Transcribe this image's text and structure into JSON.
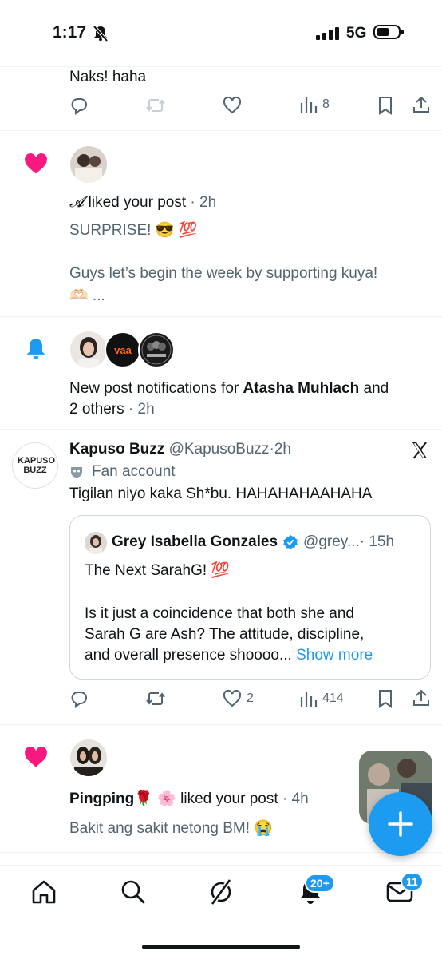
{
  "status_bar": {
    "time": "1:17",
    "network": "5G"
  },
  "post1": {
    "text": "Naks! haha",
    "views": "8"
  },
  "notif_like1": {
    "user": "𝓐",
    "action": " liked your post",
    "time": " · 2h",
    "line1": "SURPRISE! 😎 💯",
    "line2": "Guys let’s begin the week by supporting kuya!",
    "line3": "🫶🏻 ..."
  },
  "notif_post": {
    "prefix": "New post notifications for ",
    "name": "Atasha Muhlach",
    "suffix": " and",
    "line2": "2 others",
    "time": " · 2h",
    "avatar2_text": "vaa"
  },
  "tweet": {
    "avatar_text": "KAPUSO BUZZ",
    "name": "Kapuso Buzz",
    "handle": "@KapusoBuzz",
    "time": "·2h",
    "label": "Fan account",
    "text": "Tigilan niyo kaka Sh*bu. HAHAHAHAAHAHA",
    "quote": {
      "name": "Grey Isabella Gonzales",
      "handle": "@grey...",
      "time": " · 15h",
      "line1": "The Next SarahG! 💯",
      "line2": "Is it just a coincidence that both she and",
      "line3": "Sarah G are Ash? The attitude, discipline,",
      "line4": "and overall presence shoooo...",
      "show_more": " Show more"
    },
    "likes": "2",
    "views": "414"
  },
  "notif_like2": {
    "user": "Pingping",
    "emojis": "🌹 🌸",
    "action": " liked your post",
    "time": " · 4h",
    "text": "Bakit ang sakit netong BM! 😭"
  },
  "tabbar": {
    "notif_badge": "20+",
    "msg_badge": "11"
  },
  "colors": {
    "accent": "#1d9bf0",
    "like": "#f91880",
    "text": "#0f1419",
    "secondary": "#536471"
  }
}
